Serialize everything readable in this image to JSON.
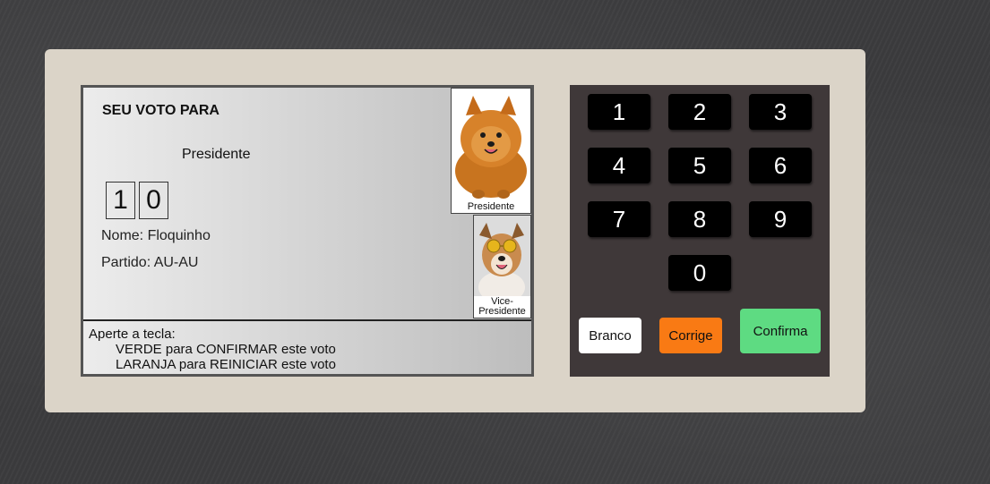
{
  "screen": {
    "header": "SEU VOTO PARA",
    "office": "Presidente",
    "digits": [
      "1",
      "0"
    ],
    "name_line": "Nome: Floquinho",
    "party_line": "Partido: AU-AU",
    "president_photo_label": "Presidente",
    "vice_photo_label": "Vice-Presidente",
    "instructions_title": "Aperte a tecla:",
    "instructions": [
      "VERDE para CONFIRMAR este voto",
      "LARANJA para REINICIAR este voto"
    ]
  },
  "keypad": {
    "keys": [
      "1",
      "2",
      "3",
      "4",
      "5",
      "6",
      "7",
      "8",
      "9",
      "0"
    ],
    "branco_label": "Branco",
    "corrige_label": "Corrige",
    "confirma_label": "Confirma"
  },
  "colors": {
    "branco": "#ffffff",
    "corrige": "#f97a14",
    "confirma": "#5edb82"
  }
}
